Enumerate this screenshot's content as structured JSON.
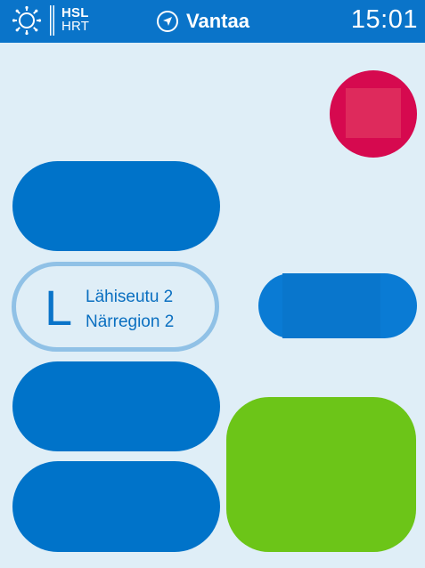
{
  "header": {
    "brand": {
      "primary": "HSL",
      "secondary": "HRT"
    },
    "location": "Vantaa",
    "time": "15:01"
  },
  "zone": {
    "letter": "L",
    "line1": "Lähiseutu 2",
    "line2": "Närregion 2"
  },
  "colors": {
    "header_bg": "#0a74c9",
    "background": "#dfeef7",
    "pill_blue": "#0073c9",
    "zone_border": "#90c1e6",
    "stop_red": "#d6094f",
    "go_green": "#6cc518"
  },
  "icons": {
    "logo": "hsl-sun-logo-icon",
    "location": "location-arrow-icon",
    "stop": "stop-square-icon"
  }
}
